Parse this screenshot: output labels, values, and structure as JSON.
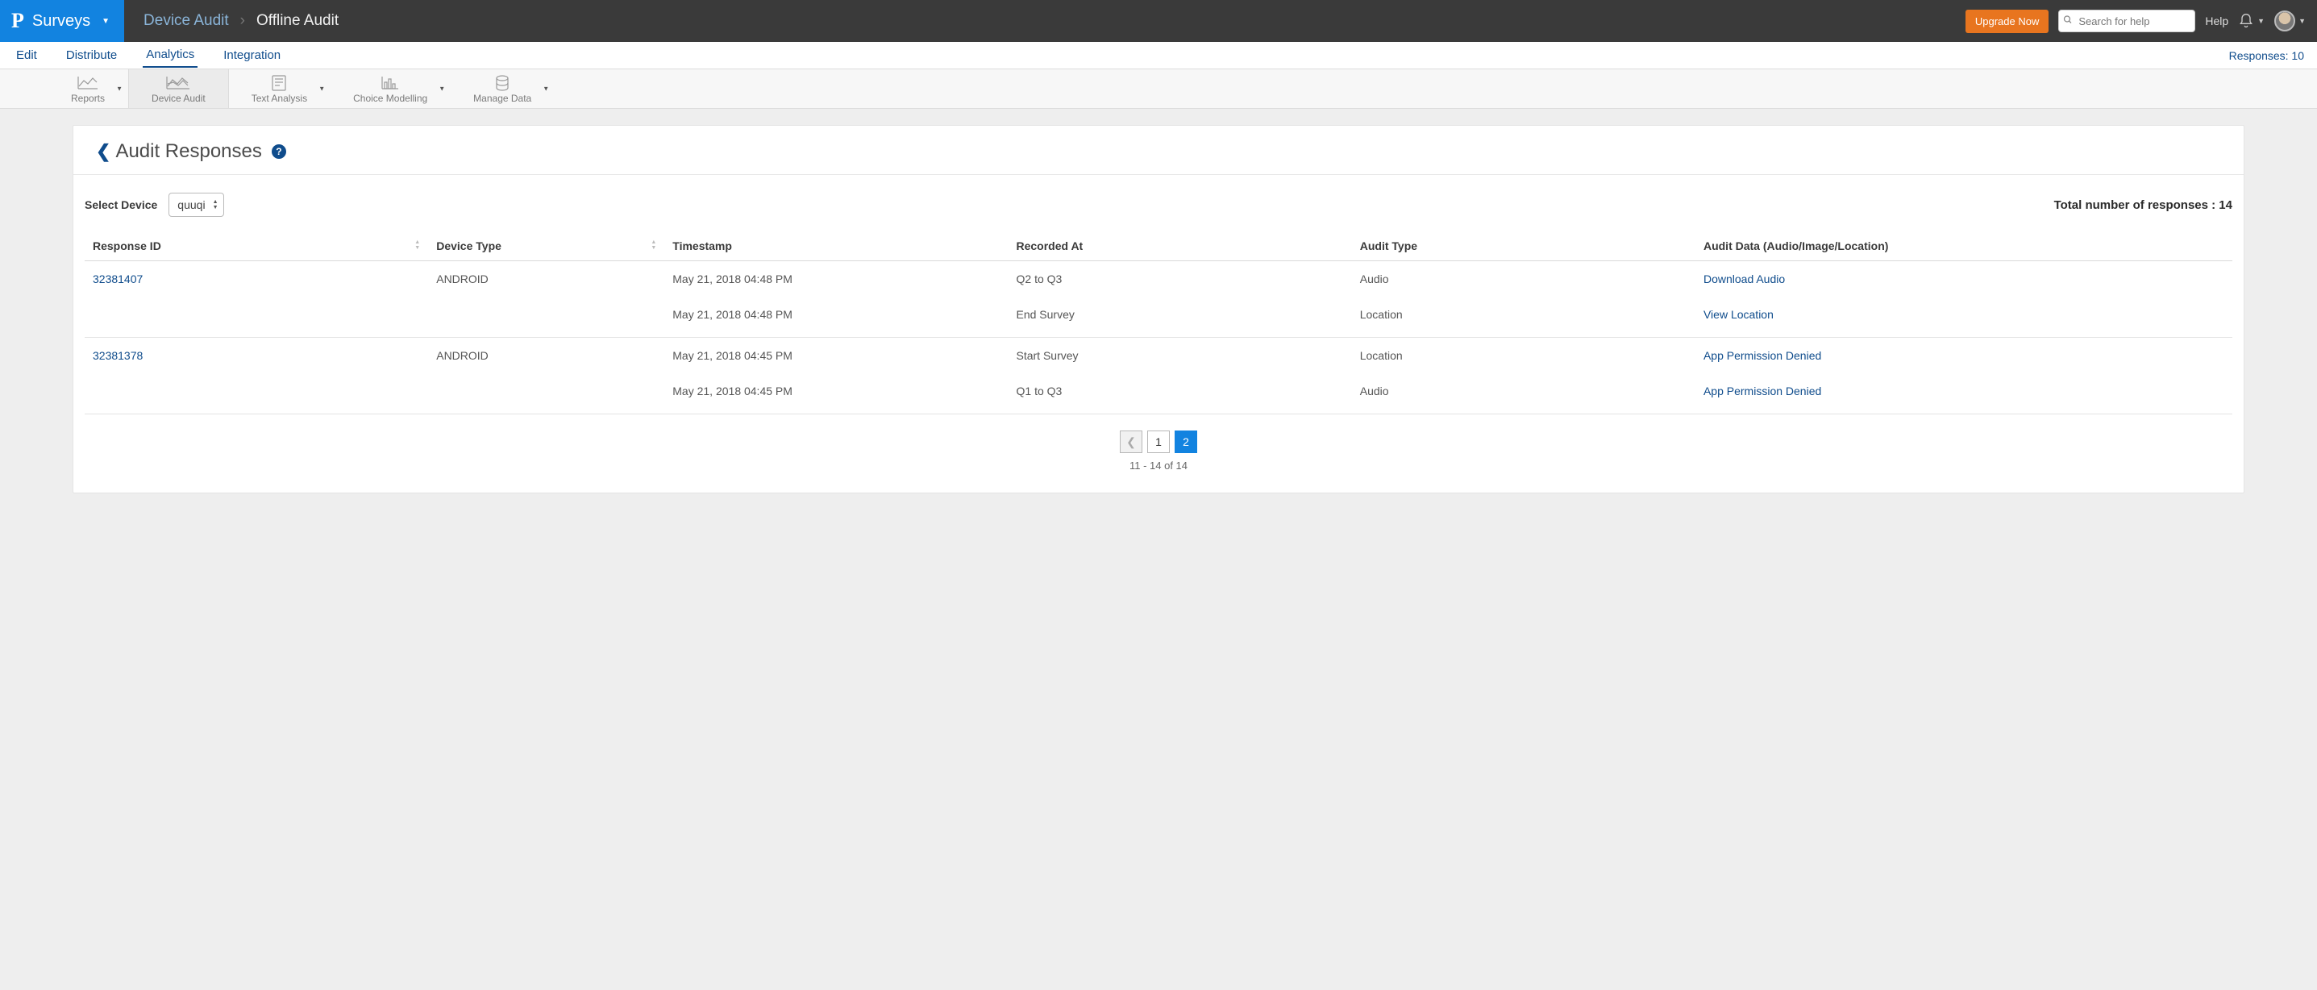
{
  "header": {
    "brand": "Surveys",
    "breadcrumb": {
      "first": "Device Audit",
      "last": "Offline Audit"
    },
    "upgrade_label": "Upgrade Now",
    "search_placeholder": "Search for help",
    "help_label": "Help"
  },
  "sec_nav": {
    "items": [
      "Edit",
      "Distribute",
      "Analytics",
      "Integration"
    ],
    "active_index": 2,
    "responses_label": "Responses: 10"
  },
  "tool_tabs": {
    "items": [
      {
        "label": "Reports",
        "has_caret": true
      },
      {
        "label": "Device Audit",
        "has_caret": false
      },
      {
        "label": "Text Analysis",
        "has_caret": true
      },
      {
        "label": "Choice Modelling",
        "has_caret": true
      },
      {
        "label": "Manage Data",
        "has_caret": true
      }
    ],
    "active_index": 1
  },
  "panel": {
    "title": "Audit Responses",
    "select_device_label": "Select Device",
    "selected_device": "quuqi",
    "total_label": "Total number of responses : 14"
  },
  "table": {
    "headers": {
      "response_id": "Response ID",
      "device_type": "Device Type",
      "timestamp": "Timestamp",
      "recorded_at": "Recorded At",
      "audit_type": "Audit Type",
      "audit_data": "Audit Data (Audio/Image/Location)"
    },
    "groups": [
      {
        "response_id": "32381407",
        "device_type": "ANDROID",
        "rows": [
          {
            "timestamp": "May 21, 2018 04:48 PM",
            "recorded_at": "Q2 to Q3",
            "audit_type": "Audio",
            "audit_data": "Download Audio"
          },
          {
            "timestamp": "May 21, 2018 04:48 PM",
            "recorded_at": "End Survey",
            "audit_type": "Location",
            "audit_data": "View Location"
          }
        ]
      },
      {
        "response_id": "32381378",
        "device_type": "ANDROID",
        "rows": [
          {
            "timestamp": "May 21, 2018 04:45 PM",
            "recorded_at": "Start Survey",
            "audit_type": "Location",
            "audit_data": "App Permission Denied"
          },
          {
            "timestamp": "May 21, 2018 04:45 PM",
            "recorded_at": "Q1 to Q3",
            "audit_type": "Audio",
            "audit_data": "App Permission Denied"
          }
        ]
      }
    ]
  },
  "pagination": {
    "pages": [
      "1",
      "2"
    ],
    "active_page_index": 1,
    "range_label": "11 - 14 of 14"
  }
}
